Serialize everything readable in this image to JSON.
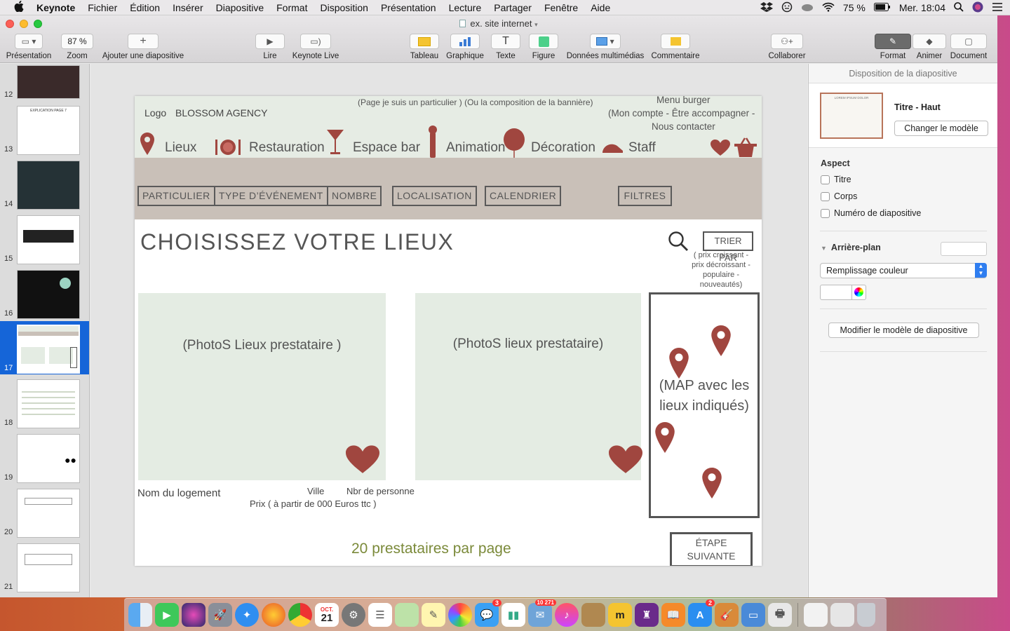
{
  "menubar": {
    "apple": "",
    "app": "Keynote",
    "items": [
      "Fichier",
      "Édition",
      "Insérer",
      "Diapositive",
      "Format",
      "Disposition",
      "Présentation",
      "Lecture",
      "Partager",
      "Fenêtre",
      "Aide"
    ],
    "battery": "75 %",
    "clock": "Mer. 18:04"
  },
  "window": {
    "title": "ex. site internet"
  },
  "toolbar": {
    "presentation": "Présentation",
    "zoom_value": "87 %",
    "zoom": "Zoom",
    "add_slide": "Ajouter une diapositive",
    "play": "Lire",
    "keynote_live": "Keynote Live",
    "table": "Tableau",
    "chart": "Graphique",
    "text": "Texte",
    "shape": "Figure",
    "media": "Données multimédias",
    "comment": "Commentaire",
    "collaborate": "Collaborer",
    "format": "Format",
    "animate": "Animer",
    "document": "Document"
  },
  "slides": [
    "12",
    "13",
    "14",
    "15",
    "16",
    "17",
    "18",
    "19",
    "20",
    "21"
  ],
  "selected_slide": "17",
  "slide": {
    "logo": "Logo",
    "brand": "BLOSSOM AGENCY",
    "banner_note": "(Page je suis un particulier ) (Ou la composition de la bannière)",
    "menu_title": "Menu burger",
    "menu_line": "(Mon compte - Être accompagner -",
    "menu_contact": "Nous contacter",
    "nav": [
      "Lieux",
      "Restauration",
      "Espace bar",
      "Animation",
      "Décoration",
      "Staff"
    ],
    "filters": [
      "PARTICULIER",
      "TYPE D’ÉVÉNEMENT",
      "NOMBRE",
      "LOCALISATION",
      "CALENDRIER",
      "FILTRES"
    ],
    "heading": "CHOISISSEZ VOTRE LIEUX",
    "sort_label": "TRIER PAR",
    "sort_options": [
      "( prix croissant -",
      "prix décroissant -",
      "populaire -",
      "nouveautés)"
    ],
    "photo1": "(PhotoS Lieux prestataire )",
    "photo2": "(PhotoS lieux prestataire)",
    "map": "(MAP avec les lieux indiqués)",
    "name": "Nom du logement",
    "city": "Ville",
    "persons": "Nbr de personne",
    "price": "Prix  ( à partir de 000 Euros ttc )",
    "per_page": "20 prestataires par page",
    "next": "ÉTAPE SUIVANTE"
  },
  "inspector": {
    "title": "Disposition de la diapositive",
    "layout_name": "Titre - Haut",
    "change_master": "Changer le modèle",
    "aspect": "Aspect",
    "opt_title": "Titre",
    "opt_body": "Corps",
    "opt_number": "Numéro de diapositive",
    "background": "Arrière-plan",
    "fill": "Remplissage couleur",
    "edit_master": "Modifier le modèle de diapositive"
  },
  "colors": {
    "accent": "#a0463f",
    "filter_band": "#c9c0b8",
    "photo_bg": "#e4ece3",
    "per_page_text": "#7b8a3a",
    "selection": "#1565d8"
  },
  "dock": {
    "messages_badge": "3",
    "mail_badge": "10 271",
    "appstore_badge": "2",
    "calendar_month": "OCT.",
    "calendar_day": "21"
  }
}
